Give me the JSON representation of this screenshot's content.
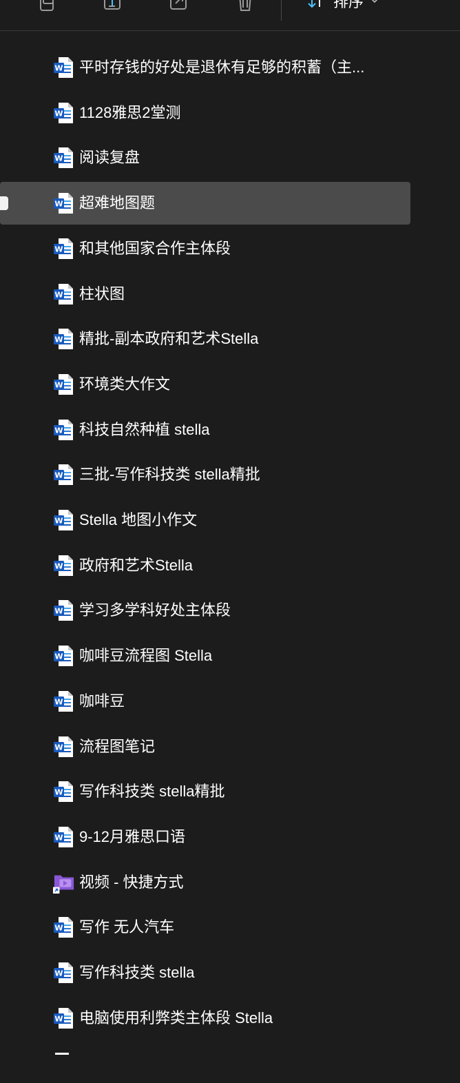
{
  "toolbar": {
    "sort_label": "排序",
    "more_label": "···",
    "icons": [
      "copy-icon",
      "rename-icon",
      "share-icon",
      "delete-icon",
      "sort-icon",
      "chevron-down-icon",
      "more-icon"
    ]
  },
  "files": [
    {
      "name": "平时存钱的好处是退休有足够的积蓄（主...",
      "type": "word"
    },
    {
      "name": "1128雅思2堂测",
      "type": "word"
    },
    {
      "name": "阅读复盘",
      "type": "word"
    },
    {
      "name": "超难地图题",
      "type": "word",
      "selected": true
    },
    {
      "name": "和其他国家合作主体段",
      "type": "word"
    },
    {
      "name": "柱状图",
      "type": "word"
    },
    {
      "name": "精批-副本政府和艺术Stella",
      "type": "word"
    },
    {
      "name": "环境类大作文",
      "type": "word"
    },
    {
      "name": "科技自然种植 stella",
      "type": "word"
    },
    {
      "name": "三批-写作科技类 stella精批",
      "type": "word"
    },
    {
      "name": "Stella 地图小作文",
      "type": "word"
    },
    {
      "name": "政府和艺术Stella",
      "type": "word"
    },
    {
      "name": "学习多学科好处主体段",
      "type": "word"
    },
    {
      "name": "咖啡豆流程图 Stella",
      "type": "word"
    },
    {
      "name": "咖啡豆",
      "type": "word"
    },
    {
      "name": "流程图笔记",
      "type": "word"
    },
    {
      "name": "写作科技类 stella精批",
      "type": "word"
    },
    {
      "name": "9-12月雅思口语",
      "type": "word"
    },
    {
      "name": "视频 - 快捷方式",
      "type": "video-shortcut"
    },
    {
      "name": "写作 无人汽车",
      "type": "word"
    },
    {
      "name": "写作科技类 stella",
      "type": "word"
    },
    {
      "name": "电脑使用利弊类主体段 Stella",
      "type": "word"
    }
  ],
  "colors": {
    "background": "#1c1c1c",
    "selected_row": "#4b4b4b",
    "word_blue": "#185abd",
    "video_purple": "#8a58d6",
    "accent": "#4cc2ff"
  }
}
